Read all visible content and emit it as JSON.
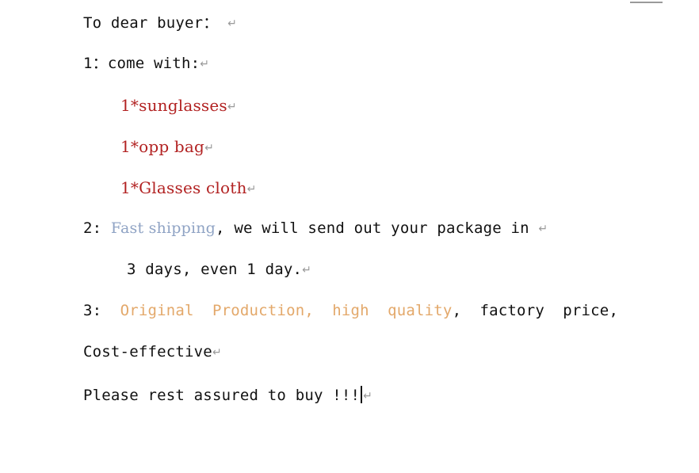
{
  "document": {
    "top_marker": "ruler-margin-marker",
    "pilcrow_glyph": "↵",
    "colors": {
      "text": "#111111",
      "red": "#b22222",
      "blue": "#8fa3c4",
      "orange": "#e3a86a",
      "pilcrow": "#9a9a9a"
    },
    "lines": [
      {
        "id": "l1",
        "name": "greeting-line",
        "runs": [
          {
            "text": "To dear buyer： ",
            "color": "black",
            "style": "mono"
          }
        ],
        "pilcrow": true
      },
      {
        "id": "l2",
        "name": "item-1-heading-line",
        "runs": [
          {
            "text": "1：come with:",
            "color": "black",
            "style": "mono"
          }
        ],
        "pilcrow": true
      },
      {
        "id": "l3",
        "name": "bullet-sunglasses-line",
        "runs": [
          {
            "text": "1*sunglasses",
            "color": "red",
            "style": "serif"
          }
        ],
        "pilcrow": true
      },
      {
        "id": "l4",
        "name": "bullet-opp-bag-line",
        "runs": [
          {
            "text": "1*opp bag",
            "color": "red",
            "style": "serif"
          }
        ],
        "pilcrow": true
      },
      {
        "id": "l5",
        "name": "bullet-glasses-cloth-line",
        "runs": [
          {
            "text": "1*Glasses cloth",
            "color": "red",
            "style": "serif"
          }
        ],
        "pilcrow": true
      },
      {
        "id": "l6",
        "name": "item-2-shipping-line",
        "runs": [
          {
            "text": "2: ",
            "color": "black",
            "style": "mono"
          },
          {
            "text": "Fast shipping",
            "color": "blue",
            "style": "serif"
          },
          {
            "text": ", we will send out your package in ",
            "color": "black",
            "style": "mono"
          }
        ],
        "pilcrow": true
      },
      {
        "id": "l7",
        "name": "shipping-days-line",
        "runs": [
          {
            "text": "3 days, even 1 day.",
            "color": "black",
            "style": "mono"
          }
        ],
        "pilcrow": true
      },
      {
        "id": "l8",
        "name": "item-3-quality-line",
        "runs": [
          {
            "text": "3:  ",
            "color": "black",
            "style": "mono"
          },
          {
            "text": "Original  Production,  high  quality",
            "color": "orange",
            "style": "mono"
          },
          {
            "text": ",  factory  price,",
            "color": "black",
            "style": "mono"
          }
        ],
        "pilcrow": false
      },
      {
        "id": "l9",
        "name": "cost-effective-line",
        "runs": [
          {
            "text": "Cost-effective",
            "color": "black",
            "style": "mono"
          }
        ],
        "pilcrow": true
      },
      {
        "id": "l10",
        "name": "closing-line",
        "runs": [
          {
            "text": "Please rest assured to buy !!!",
            "color": "black",
            "style": "mono"
          }
        ],
        "pilcrow": true,
        "caret": true
      }
    ]
  }
}
